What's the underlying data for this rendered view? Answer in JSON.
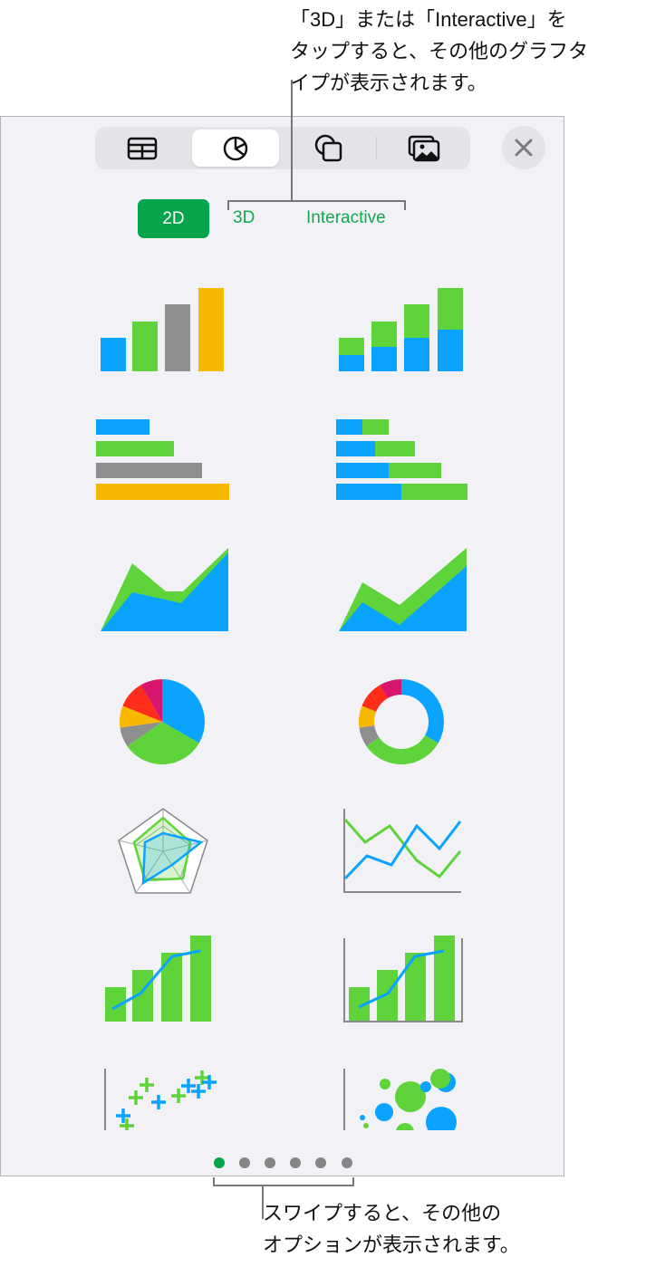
{
  "annotations": {
    "top": [
      "「3D」または「Interactive」を",
      "タップすると、その他のグラフタ",
      "イプが表示されます。"
    ],
    "bottom": [
      "スワイプすると、その他の",
      "オプションが表示されます。"
    ]
  },
  "toolbar": {
    "tabs": [
      {
        "icon": "table-icon",
        "selected": false
      },
      {
        "icon": "chart-icon",
        "selected": true
      },
      {
        "icon": "shapes-icon",
        "selected": false
      },
      {
        "icon": "media-icon",
        "selected": false
      }
    ],
    "close_icon": "close-icon"
  },
  "chart_tabs": {
    "items": [
      "2D",
      "3D",
      "Interactive"
    ],
    "selected": "2D"
  },
  "chart_types": [
    "column",
    "stacked-column",
    "bar",
    "stacked-bar",
    "area",
    "stacked-area",
    "pie",
    "donut",
    "radar",
    "line",
    "mixed",
    "two-axis",
    "scatter",
    "bubble"
  ],
  "pagination": {
    "pages": 6,
    "current": 1
  },
  "colors": {
    "accent": "#07a44e",
    "blue": "#0aa3ff",
    "green": "#5fd43a",
    "gray": "#8e8e8e",
    "yellow": "#f9b800",
    "red": "#ff2d1a",
    "magenta": "#d6166f"
  }
}
